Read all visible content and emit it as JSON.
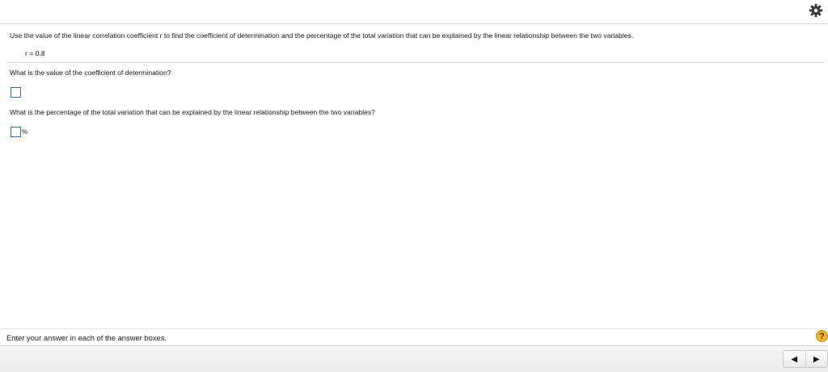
{
  "question": {
    "prompt": "Use the value of the linear correlation coefficient r to find the coefficient of determination and the percentage of the total variation that can be explained by the linear relationship between the two variables.",
    "given": "r = 0.8",
    "part1_label": "What is the value of the coefficient of determination?",
    "part1_value": "",
    "part2_label": "What is the percentage of the total variation that can be explained by the linear relationship between the two variables?",
    "part2_value": "",
    "part2_unit": "%"
  },
  "footer": {
    "instruction": "Enter your answer in each of the answer boxes.",
    "help_label": "?",
    "prev_label": "◀",
    "next_label": "▶"
  },
  "icons": {
    "settings": "gear-icon",
    "help": "help-icon",
    "previous": "previous-arrow-icon",
    "next": "next-arrow-icon"
  },
  "colors": {
    "answer_box_border": "#2e6fb5",
    "help_badge": "#f2b437"
  }
}
